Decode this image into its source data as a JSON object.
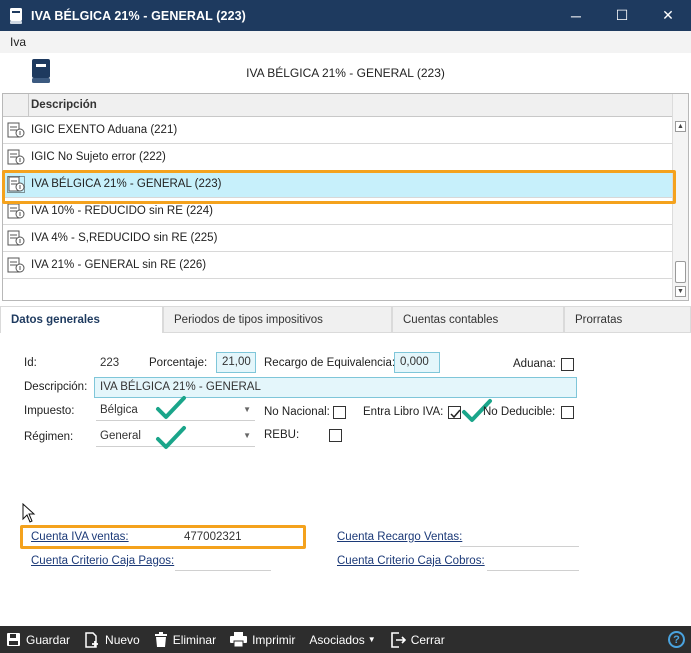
{
  "window": {
    "title": "IVA BÉLGICA 21% - GENERAL (223)",
    "controls": {
      "minimize": "─",
      "maximize": "☐",
      "close": "✕"
    }
  },
  "menu": {
    "items": [
      "Iva"
    ]
  },
  "header": {
    "title": "IVA BÉLGICA 21% - GENERAL (223)"
  },
  "grid": {
    "column": "Descripción",
    "rows": [
      "IGIC EXENTO Aduana (221)",
      "IGIC No Sujeto error (222)",
      "IVA BÉLGICA 21% - GENERAL (223)",
      "IVA 10% - REDUCIDO sin RE (224)",
      "IVA 4% - S,REDUCIDO sin RE (225)",
      "IVA 21% - GENERAL sin RE (226)"
    ],
    "selected_index": 2
  },
  "tabs": [
    "Datos generales",
    "Periodos de tipos impositivos",
    "Cuentas contables",
    "Prorratas"
  ],
  "form": {
    "id_label": "Id:",
    "id_value": "223",
    "porcentaje_label": "Porcentaje:",
    "porcentaje_value": "21,00",
    "recargo_label": "Recargo de Equivalencia:",
    "recargo_value": "0,000",
    "aduana_label": "Aduana:",
    "descripcion_label": "Descripción:",
    "descripcion_value": "IVA BÉLGICA 21% - GENERAL",
    "impuesto_label": "Impuesto:",
    "impuesto_value": "Bélgica",
    "no_nacional_label": "No Nacional:",
    "entra_libro_label": "Entra Libro IVA:",
    "no_deducible_label": "No Deducible:",
    "regimen_label": "Régimen:",
    "regimen_value": "General",
    "rebu_label": "REBU:",
    "cuenta_iva_ventas_label": "Cuenta IVA ventas:",
    "cuenta_iva_ventas_value": "477002321",
    "cuenta_recargo_ventas_label": "Cuenta Recargo Ventas:",
    "cuenta_criterio_pagos_label": "Cuenta Criterio Caja Pagos:",
    "cuenta_criterio_cobros_label": "Cuenta Criterio Caja Cobros:",
    "checks": {
      "aduana": false,
      "no_nacional": false,
      "entra_libro_iva": true,
      "no_deducible": false,
      "rebu": false
    }
  },
  "toolbar": {
    "guardar": "Guardar",
    "nuevo": "Nuevo",
    "eliminar": "Eliminar",
    "imprimir": "Imprimir",
    "asociados": "Asociados",
    "cerrar": "Cerrar",
    "help": "?"
  },
  "colors": {
    "titlebar": "#1e3a5f",
    "selection": "#c7f0fb",
    "highlight": "#f4a21d",
    "checkmark": "#1aa58a",
    "toolbar": "#2d2d2d"
  }
}
